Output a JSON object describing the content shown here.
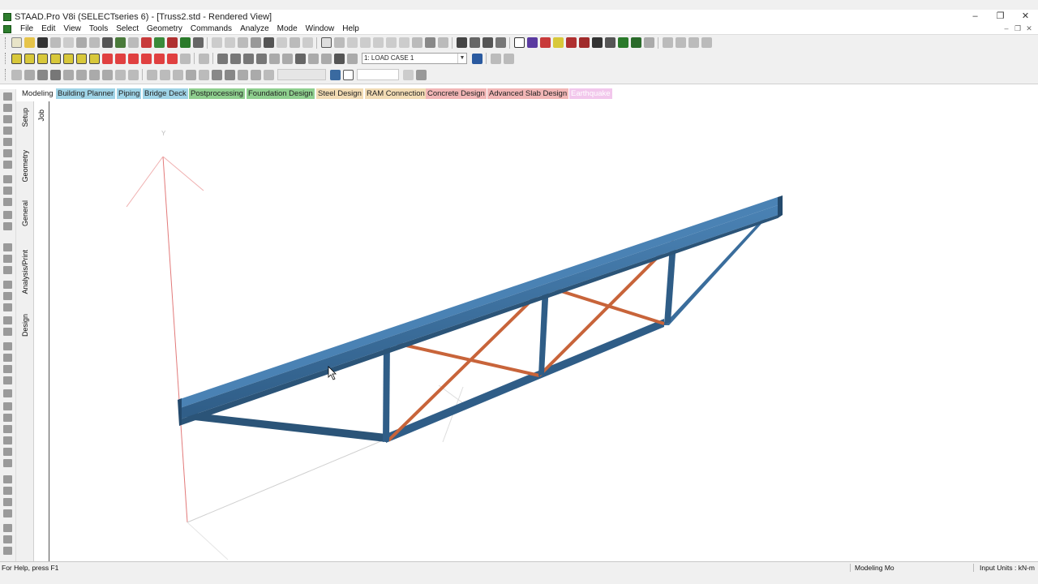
{
  "window": {
    "title": "STAAD.Pro V8i (SELECTseries 6) - [Truss2.std - Rendered View]",
    "controls": [
      "–",
      "❐",
      "✕"
    ],
    "mdi_controls": [
      "–",
      "❐",
      "✕"
    ]
  },
  "menu": [
    "File",
    "Edit",
    "View",
    "Tools",
    "Select",
    "Geometry",
    "Commands",
    "Analyze",
    "Mode",
    "Window",
    "Help"
  ],
  "toolbar": {
    "load_case": "1: LOAD CASE 1"
  },
  "modes": {
    "modeling": "Modeling",
    "building_planner": "Building Planner",
    "piping": "Piping",
    "bridge_deck": "Bridge Deck",
    "postprocessing": "Postprocessing",
    "foundation_design": "Foundation Design",
    "steel_design": "Steel Design",
    "ram_connection": "RAM Connection",
    "concrete_design": "Concrete Design",
    "advanced_slab_design": "Advanced Slab Design",
    "earthquake": "Earthquake"
  },
  "mode_colors": {
    "building_planner": "#9fd3e6",
    "piping": "#9fd3e6",
    "bridge_deck": "#9fd3e6",
    "postprocessing": "#8fcf8f",
    "foundation_design": "#8fcf8f",
    "steel_design": "#f2dcb5",
    "ram_connection": "#f2dcb5",
    "concrete_design": "#f2b6b6",
    "advanced_slab_design": "#f2b6b6",
    "earthquake": "#f2c7ec"
  },
  "page_control": {
    "job": "Job",
    "setup": "Setup",
    "geometry": "Geometry",
    "general": "General",
    "analysis_print": "Analysis/Print",
    "design": "Design"
  },
  "viewport": {
    "axis_y_label": "Y",
    "colors": {
      "beam": "#3a6d9c",
      "beam_dark": "#2b5478",
      "bracing": "#c8643a",
      "axis": "#e27a7a"
    }
  },
  "status": {
    "help": "For Help, press F1",
    "mode": "Modeling Mo",
    "units": "Input Units : kN-m"
  }
}
